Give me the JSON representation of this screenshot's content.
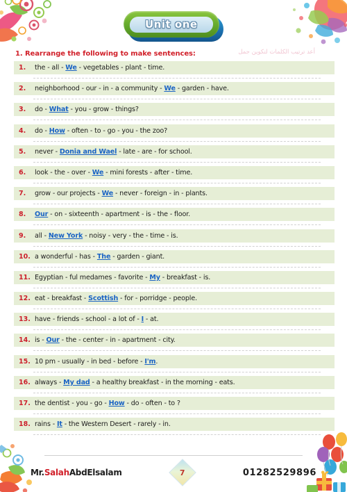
{
  "header": {
    "unit_title": "Unit one"
  },
  "instruction": {
    "number_label": "1.",
    "text": "1. Rearrange the following to make sentences:",
    "arabic_note": "أعد ترتيب الكلمات لتكوين جمل"
  },
  "questions": [
    {
      "num": "1.",
      "pre": "the - all - ",
      "hint": "We",
      "post": " - vegetables - plant - time."
    },
    {
      "num": "2.",
      "pre": "neighborhood - our - in - a community - ",
      "hint": "We",
      "post": " - garden - have."
    },
    {
      "num": "3.",
      "pre": "do - ",
      "hint": "What",
      "post": " - you - grow - things?"
    },
    {
      "num": "4.",
      "pre": "do - ",
      "hint": "How",
      "post": " - often - to - go - you - the zoo?"
    },
    {
      "num": "5.",
      "pre": "never - ",
      "hint": "Donia and Wael",
      "post": " - late - are - for school."
    },
    {
      "num": "6.",
      "pre": "look - the - over - ",
      "hint": "We",
      "post": " - mini forests - after - time."
    },
    {
      "num": "7.",
      "pre": "grow - our projects - ",
      "hint": "We",
      "post": " - never - foreign - in - plants."
    },
    {
      "num": "8.",
      "pre": "",
      "hint": "Our",
      "post": " - on - sixteenth - apartment - is - the - floor."
    },
    {
      "num": "9.",
      "pre": "all - ",
      "hint": "New York",
      "post": " - noisy - very - the - time - is."
    },
    {
      "num": "10.",
      "pre": "a wonderful - has - ",
      "hint": "The",
      "post": " - garden - giant."
    },
    {
      "num": "11.",
      "pre": "Egyptian - ful medames - favorite - ",
      "hint": "My",
      "post": " - breakfast - is."
    },
    {
      "num": "12.",
      "pre": "eat - breakfast - ",
      "hint": "Scottish",
      "post": " - for - porridge - people."
    },
    {
      "num": "13.",
      "pre": "have - friends - school - a lot of - ",
      "hint": "I",
      "post": " - at."
    },
    {
      "num": "14.",
      "pre": "is - ",
      "hint": "Our",
      "post": " - the - center - in - apartment - city."
    },
    {
      "num": "15.",
      "pre": "10 pm - usually - in bed - before - ",
      "hint": "I'm",
      "post": "."
    },
    {
      "num": "16.",
      "pre": "always - ",
      "hint": "My dad",
      "post": " - a healthy breakfast - in the morning - eats."
    },
    {
      "num": "17.",
      "pre": "the dentist - you - go - ",
      "hint": "How",
      "post": " - do - often - to ?"
    },
    {
      "num": "18.",
      "pre": "rains - ",
      "hint": "It",
      "post": " - the Western Desert - rarely - in."
    }
  ],
  "footer": {
    "teacher_prefix": "Mr.",
    "teacher_first": "Salah",
    "teacher_last": "AbdElsalam",
    "page_number": "7",
    "phone": "01282529896"
  },
  "colors": {
    "band": "#e6eed6",
    "number": "#cc1f2b",
    "hint": "#1a63c4",
    "instruction": "#d1202a",
    "banner_green": "#63a92b",
    "banner_blue": "#1a6fae"
  }
}
